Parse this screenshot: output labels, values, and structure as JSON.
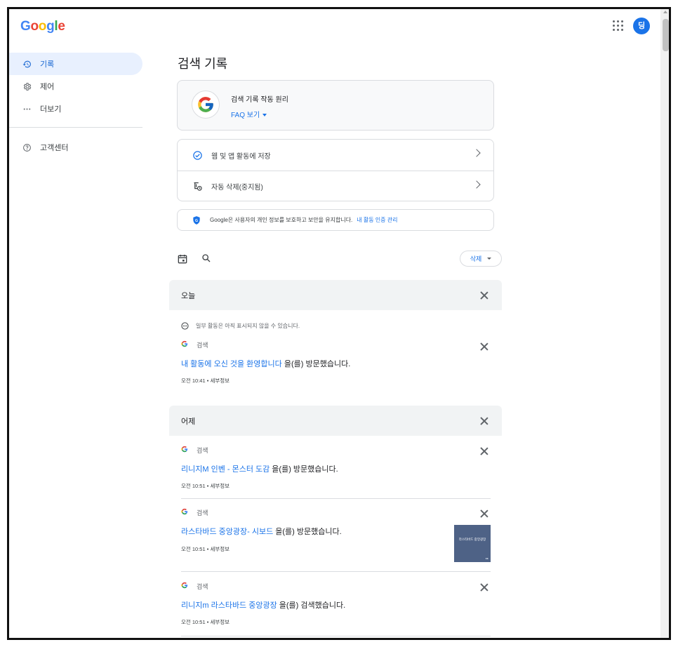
{
  "header": {
    "logo_letters": [
      {
        "ch": "G",
        "color": "#4285f4"
      },
      {
        "ch": "o",
        "color": "#ea4335"
      },
      {
        "ch": "o",
        "color": "#fbbc05"
      },
      {
        "ch": "g",
        "color": "#4285f4"
      },
      {
        "ch": "l",
        "color": "#34a853"
      },
      {
        "ch": "e",
        "color": "#ea4335"
      }
    ],
    "apps_icon": "apps-grid-icon",
    "avatar_initial": "딩",
    "avatar_color": "#1a73e8"
  },
  "sidebar": {
    "items": [
      {
        "label": "기록",
        "icon": "history-icon",
        "active": true
      },
      {
        "label": "제어",
        "icon": "settings-gear-icon",
        "active": false
      },
      {
        "label": "더보기",
        "icon": "more-horiz-icon",
        "active": false
      }
    ],
    "help": {
      "label": "고객센터",
      "icon": "help-icon"
    }
  },
  "main": {
    "title": "검색 기록",
    "how_card": {
      "title": "검색 기록 작동 원리",
      "faq_label": "FAQ 보기"
    },
    "settings": [
      {
        "label": "웹 및 앱 활동에 저장",
        "icon": "check-circle-icon"
      },
      {
        "label": "자동 삭제(중지됨)",
        "icon": "auto-delete-icon"
      }
    ],
    "privacy": {
      "text": "Google은 사용자의 개인 정보를 보호하고 보안을 유지합니다.",
      "link": "내 활동 인증 관리"
    },
    "toolbar": {
      "calendar_icon": "calendar-icon",
      "search_icon": "search-icon",
      "delete_label": "삭제"
    },
    "today": {
      "label": "오늘",
      "notice": "일부 활동은 아직 표시되지 않을 수 있습니다.",
      "items": [
        {
          "source": "검색",
          "link_text": "내 활동에 오신 것을 환영합니다",
          "suffix": " 을(를) 방문했습니다.",
          "time": "오전 10:41",
          "details": "세부정보"
        }
      ]
    },
    "yesterday": {
      "label": "어제",
      "items": [
        {
          "source": "검색",
          "link_text": "리니지M 인벤 - 몬스터 도감",
          "suffix": " 을(를) 방문했습니다.",
          "time": "오전 10:51",
          "details": "세부정보"
        },
        {
          "source": "검색",
          "link_text": "라스타바드 중앙광장- 시보드",
          "suffix": " 을(를) 방문했습니다.",
          "time": "오전 10:51",
          "details": "세부정보",
          "thumbnail_text": "라스타바드 중앙광장"
        },
        {
          "source": "검색",
          "link_text": "리니지m 라스타바드 중앙광장",
          "suffix": " 을(를) 검색했습니다.",
          "time": "오전 10:51",
          "details": "세부정보"
        }
      ]
    },
    "separator": " • "
  }
}
